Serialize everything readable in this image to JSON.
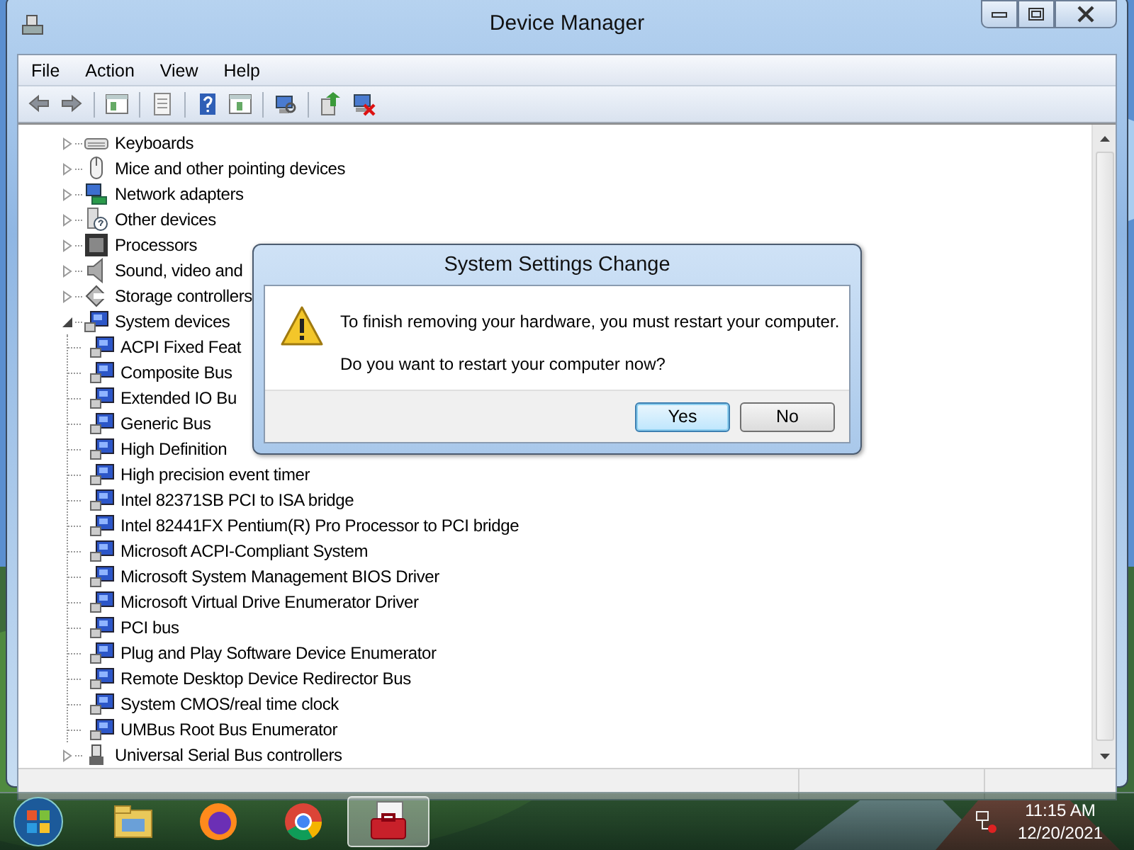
{
  "window": {
    "title": "Device Manager"
  },
  "menu": [
    "File",
    "Action",
    "View",
    "Help"
  ],
  "tree": [
    {
      "label": "Keyboards",
      "kind": "keyboard",
      "expanded": false
    },
    {
      "label": "Mice and other pointing devices",
      "kind": "mouse",
      "expanded": false
    },
    {
      "label": "Network adapters",
      "kind": "network",
      "expanded": false
    },
    {
      "label": "Other devices",
      "kind": "unknown",
      "expanded": false
    },
    {
      "label": "Processors",
      "kind": "processor",
      "expanded": false
    },
    {
      "label": "Sound, video and",
      "kind": "sound",
      "expanded": false
    },
    {
      "label": "Storage controllers",
      "kind": "storage",
      "expanded": false
    },
    {
      "label": "System devices",
      "kind": "system",
      "expanded": true,
      "children": [
        {
          "label": "ACPI Fixed Feat",
          "kind": "system"
        },
        {
          "label": "Composite Bus",
          "kind": "system"
        },
        {
          "label": "Extended IO Bu",
          "kind": "system"
        },
        {
          "label": "Generic Bus",
          "kind": "system"
        },
        {
          "label": "High Definition",
          "kind": "system"
        },
        {
          "label": "High precision event timer",
          "kind": "system"
        },
        {
          "label": "Intel 82371SB PCI to ISA bridge",
          "kind": "system"
        },
        {
          "label": "Intel 82441FX Pentium(R) Pro Processor to PCI bridge",
          "kind": "system"
        },
        {
          "label": "Microsoft ACPI-Compliant System",
          "kind": "system"
        },
        {
          "label": "Microsoft System Management BIOS Driver",
          "kind": "system"
        },
        {
          "label": "Microsoft Virtual Drive Enumerator Driver",
          "kind": "system"
        },
        {
          "label": "PCI bus",
          "kind": "system"
        },
        {
          "label": "Plug and Play Software Device Enumerator",
          "kind": "system"
        },
        {
          "label": "Remote Desktop Device Redirector Bus",
          "kind": "system"
        },
        {
          "label": "System CMOS/real time clock",
          "kind": "system"
        },
        {
          "label": "UMBus Root Bus Enumerator",
          "kind": "system"
        }
      ]
    },
    {
      "label": "Universal Serial Bus controllers",
      "kind": "usb",
      "expanded": false
    }
  ],
  "dialog": {
    "title": "System Settings Change",
    "message": "To finish removing your hardware, you must restart your computer.",
    "question": "Do you want to restart your computer now?",
    "buttons": [
      {
        "label": "Yes",
        "default": true
      },
      {
        "label": "No",
        "default": false
      }
    ]
  },
  "taskbar": {
    "apps": [
      {
        "kind": "folder",
        "selected": false
      },
      {
        "kind": "firefox",
        "selected": false
      },
      {
        "kind": "chrome",
        "selected": false
      },
      {
        "kind": "toolbox",
        "selected": true
      }
    ],
    "time": "11:15 AM",
    "date": "12/20/2021"
  }
}
